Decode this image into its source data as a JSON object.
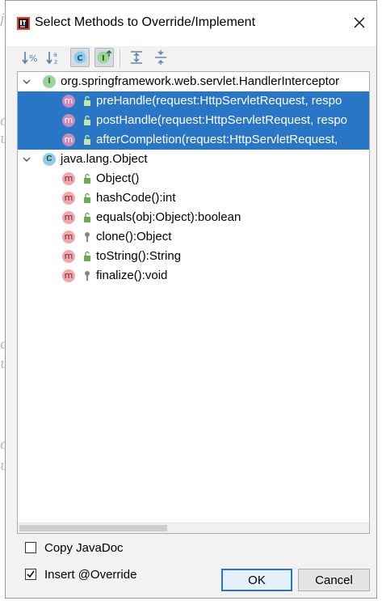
{
  "dialog": {
    "title": "Select Methods to Override/Implement",
    "close_icon": "close-icon"
  },
  "toolbar": {
    "buttons": [
      {
        "name": "sort-by-visibility-button",
        "icon": "sort-visibility-icon",
        "active": false
      },
      {
        "name": "sort-alphabetically-button",
        "icon": "sort-alpha-icon",
        "active": false
      },
      {
        "name": "show-classes-button",
        "icon": "class-icon",
        "active": true
      },
      {
        "name": "show-interfaces-button",
        "icon": "interface-icon",
        "active": true
      },
      {
        "name": "expand-all-button",
        "icon": "expand-all-icon",
        "active": false
      },
      {
        "name": "collapse-all-button",
        "icon": "collapse-all-icon",
        "active": false
      }
    ]
  },
  "tree": {
    "groups": [
      {
        "label": "org.springframework.web.servlet.HandlerInterceptor",
        "icon": "interface-icon",
        "icon_letter": "I",
        "icon_color": "#9cd49a",
        "methods": [
          {
            "label": "preHandle(request:HttpServletRequest, respo",
            "visibility": "public",
            "selected": true
          },
          {
            "label": "postHandle(request:HttpServletRequest, respo",
            "visibility": "public",
            "selected": true
          },
          {
            "label": "afterCompletion(request:HttpServletRequest, ",
            "visibility": "public",
            "selected": true
          }
        ]
      },
      {
        "label": "java.lang.Object",
        "icon": "class-icon",
        "icon_letter": "C",
        "icon_color": "#8fcbe8",
        "methods": [
          {
            "label": "Object()",
            "visibility": "public",
            "selected": false
          },
          {
            "label": "hashCode():int",
            "visibility": "public",
            "selected": false
          },
          {
            "label": "equals(obj:Object):boolean",
            "visibility": "public",
            "selected": false
          },
          {
            "label": "clone():Object",
            "visibility": "protected",
            "selected": false
          },
          {
            "label": "toString():String",
            "visibility": "public",
            "selected": false
          },
          {
            "label": "finalize():void",
            "visibility": "protected",
            "selected": false
          }
        ]
      }
    ],
    "method_icon_letter": "m"
  },
  "options": {
    "copy_javadoc": {
      "label": "Copy JavaDoc",
      "checked": false
    },
    "insert_override": {
      "label": "Insert @Override",
      "checked": true
    }
  },
  "buttons": {
    "ok": "OK",
    "cancel": "Cancel"
  },
  "colors": {
    "selection": "#2a76c6",
    "method_icon": "#f4a6b0"
  }
}
